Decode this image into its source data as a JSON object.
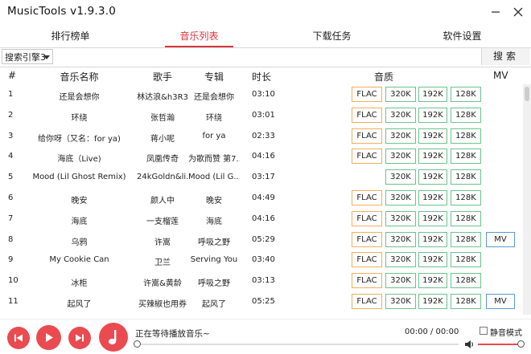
{
  "app": {
    "title": "MusicTools v1.9.3.0"
  },
  "tabs": [
    {
      "label": "排行榜单",
      "active": false
    },
    {
      "label": "音乐列表",
      "active": true
    },
    {
      "label": "下载任务",
      "active": false
    },
    {
      "label": "软件设置",
      "active": false
    }
  ],
  "search": {
    "engine": "搜索引擎3",
    "placeholder": "",
    "value": "",
    "button": "搜索"
  },
  "columns": {
    "no": "#",
    "name": "音乐名称",
    "artist": "歌手",
    "album": "专辑",
    "duration": "时长",
    "quality": "音质",
    "mv": "MV"
  },
  "quality_labels": {
    "flac": "FLAC",
    "q320": "320K",
    "q192": "192K",
    "q128": "128K",
    "mv": "MV"
  },
  "songs": [
    {
      "no": "1",
      "name": "还是会想你",
      "artist": "林达浪&h3R3",
      "album": "还是会想你",
      "duration": "03:10",
      "flac": true,
      "mv": false
    },
    {
      "no": "2",
      "name": "环绕",
      "artist": "张哲瀚",
      "album": "环绕",
      "duration": "03:01",
      "flac": true,
      "mv": false
    },
    {
      "no": "3",
      "name": "给你呀（又名：for ya)",
      "artist": "蒋小呢",
      "album": "for ya",
      "duration": "02:33",
      "flac": true,
      "mv": false
    },
    {
      "no": "4",
      "name": "海底（Live)",
      "artist": "凤凰传奇",
      "album": "为歌而赞 第7...",
      "duration": "04:16",
      "flac": true,
      "mv": false
    },
    {
      "no": "5",
      "name": "Mood (Lil Ghost Remix)",
      "artist": "24kGoldn&li...",
      "album": "Mood (Lil G...",
      "duration": "03:17",
      "flac": false,
      "mv": false
    },
    {
      "no": "6",
      "name": "晚安",
      "artist": "颜人中",
      "album": "晚安",
      "duration": "04:49",
      "flac": true,
      "mv": false
    },
    {
      "no": "7",
      "name": "海底",
      "artist": "一支榴莲",
      "album": "海底",
      "duration": "04:16",
      "flac": true,
      "mv": false
    },
    {
      "no": "8",
      "name": "乌鸦",
      "artist": "许嵩",
      "album": "呼吸之野",
      "duration": "05:29",
      "flac": true,
      "mv": true
    },
    {
      "no": "9",
      "name": "My Cookie Can",
      "artist": "卫兰",
      "album": "Serving You",
      "duration": "03:40",
      "flac": true,
      "mv": false
    },
    {
      "no": "10",
      "name": "冰柜",
      "artist": "许嵩&黄龄",
      "album": "呼吸之野",
      "duration": "03:13",
      "flac": true,
      "mv": false
    },
    {
      "no": "11",
      "name": "起风了",
      "artist": "买辣椒也用券",
      "album": "起风了",
      "duration": "05:25",
      "flac": true,
      "mv": true
    }
  ],
  "player": {
    "status": "正在等待播放音乐~",
    "time": "00:00 / 00:00",
    "progress": 0,
    "mute_label": "静音模式",
    "mute": false,
    "volume": 1.0
  },
  "colors": {
    "accent": "#d9363e",
    "player_button": "#e94b50",
    "flac_border": "#f0b05a",
    "quality_border": "#6cc38e",
    "mv_border": "#5b9bd5"
  }
}
